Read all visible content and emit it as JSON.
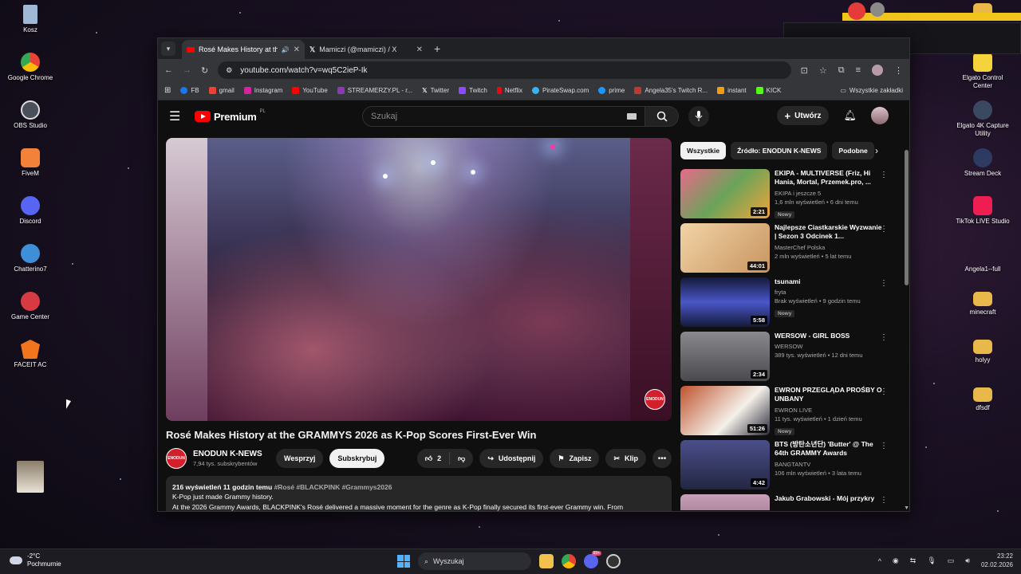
{
  "desktop_left": [
    {
      "label": "Kosz",
      "color": "#9fb8d6"
    },
    {
      "label": "Google Chrome",
      "color": "#e8b63a"
    },
    {
      "label": "OBS Studio",
      "color": "#4a4f5c"
    },
    {
      "label": "FiveM",
      "color": "#f2813a"
    },
    {
      "label": "Discord",
      "color": "#5865f2"
    },
    {
      "label": "Chatterino7",
      "color": "#3e8fd8"
    },
    {
      "label": "Game Center",
      "color": "#d63b43"
    },
    {
      "label": "FACEIT AC",
      "color": "#f2741d"
    }
  ],
  "desktop_right": [
    {
      "label": "Elgato Control Center",
      "color": "#f5d43b"
    },
    {
      "label": "Elgato 4K Capture Utility",
      "color": "#3a4960"
    },
    {
      "label": "Stream Deck",
      "color": "#2d3a62"
    },
    {
      "label": "TikTok LIVE Studio",
      "color": "#ee1d52"
    },
    {
      "label": "Angela1--full",
      "color": "#2a2a2a"
    },
    {
      "label": "minecraft",
      "color": "#e8b94a"
    },
    {
      "label": "holyy",
      "color": "#e8b94a"
    },
    {
      "label": "dfsdf",
      "color": "#e8b94a"
    }
  ],
  "browser": {
    "tabs": [
      {
        "title": "Rosé Makes History at the G",
        "active": true
      },
      {
        "title": "Mamiczi (@mamiczi) / X",
        "active": false
      }
    ],
    "new_tab": "+",
    "url": "youtube.com/watch?v=wq5C2ieP-Ik",
    "bookmarks": [
      {
        "label": "FB",
        "color": "#1877f2"
      },
      {
        "label": "gmail",
        "color": "#ea4335"
      },
      {
        "label": "Instagram",
        "color": "#d6249f"
      },
      {
        "label": "YouTube",
        "color": "#ff0000"
      },
      {
        "label": "STREAMERZY.PL - r...",
        "color": "#8a3ab9"
      },
      {
        "label": "Twitter",
        "color": "#222222"
      },
      {
        "label": "Twitch",
        "color": "#9146ff"
      },
      {
        "label": "Netflix",
        "color": "#e50914"
      },
      {
        "label": "PirateSwap.com",
        "color": "#3bb3f0"
      },
      {
        "label": "prime",
        "color": "#1a98ff"
      },
      {
        "label": "Angela35's Twitch R...",
        "color": "#c0392b"
      },
      {
        "label": "instant",
        "color": "#f39c12"
      },
      {
        "label": "KICK",
        "color": "#53fc18"
      }
    ],
    "all_bookmarks": "Wszystkie zakładki"
  },
  "youtube": {
    "logo": "Premium",
    "logo_region": "PL",
    "search_placeholder": "Szukaj",
    "create_label": "Utwórz",
    "video": {
      "title": "Rosé Makes History at the GRAMMYS 2026 as K-Pop Scores First-Ever Win",
      "channel": "ENODUN K-NEWS",
      "channel_badge": "ENODUN",
      "subscribers": "7,94 tys. subskrybentów",
      "support_label": "Wesprzyj",
      "subscribe_label": "Subskrybuj",
      "likes": "2",
      "share_label": "Udostępnij",
      "save_label": "Zapisz",
      "clip_label": "Klip",
      "views_time": "216 wyświetleń  11 godzin temu",
      "hashtags": "#Rosé #BLACKPINK #Grammys2026",
      "desc_line1": "K-Pop just made Grammy history.",
      "desc_line2": "At the 2026 Grammy Awards, BLACKPINK's Rosé delivered a massive moment for the genre as K-Pop finally secured its first-ever Grammy win. From"
    },
    "chips": [
      "Wszystkie",
      "Źródło: ENODUN K-NEWS",
      "Podobne"
    ],
    "recommendations": [
      {
        "title": "EKIPA - MULTIVERSE (Friz, Hi Hania, Mortal, Przemek.pro, ...",
        "channel": "EKIPA i jeszcze 5",
        "stats": "1,6 mln wyświetleń • 6 dni temu",
        "badge": "Nowy",
        "duration": "2:21",
        "thumb": "#c9566a"
      },
      {
        "title": "Najlepsze Ciastkarskie Wyzwanie | Sezon 3 Odcinek 1...",
        "channel": "MasterChef Polska",
        "stats": "2 mln wyświetleń • 5 lat temu",
        "badge": "",
        "duration": "44:01",
        "thumb": "#d8b08a"
      },
      {
        "title": "tsunami",
        "channel": "fryta",
        "stats": "Brak wyświetleń • 9 godzin temu",
        "badge": "Nowy",
        "duration": "5:58",
        "thumb": "#3d3f8a"
      },
      {
        "title": "WERSOW - GIRL BOSS",
        "channel": "WERSOW",
        "stats": "389 tys. wyświetleń • 12 dni temu",
        "badge": "",
        "duration": "2:34",
        "thumb": "#6a6a6e"
      },
      {
        "title": "EWRON PRZEGLĄDA PROŚBY O UNBANY",
        "channel": "EWRON LIVE",
        "stats": "11 tys. wyświetleń • 1 dzień temu",
        "badge": "Nowy",
        "duration": "51:26",
        "thumb": "#b8523a"
      },
      {
        "title": "BTS (방탄소년단) 'Butter' @ The 64th GRAMMY Awards",
        "channel": "BANGTANTV",
        "stats": "106 mln wyświetleń • 3 lata temu",
        "badge": "",
        "duration": "4:42",
        "thumb": "#3b3f66"
      },
      {
        "title": "Jakub Grabowski - Mój przykry",
        "channel": "",
        "stats": "",
        "badge": "",
        "duration": "",
        "thumb": "#a88a9a"
      }
    ]
  },
  "taskbar": {
    "temperature": "-2°C",
    "weather": "Pochmurnie",
    "search_label": "Wyszukaj",
    "time": "23:22",
    "date": "02.02.2026",
    "discord_badge": "99+"
  }
}
